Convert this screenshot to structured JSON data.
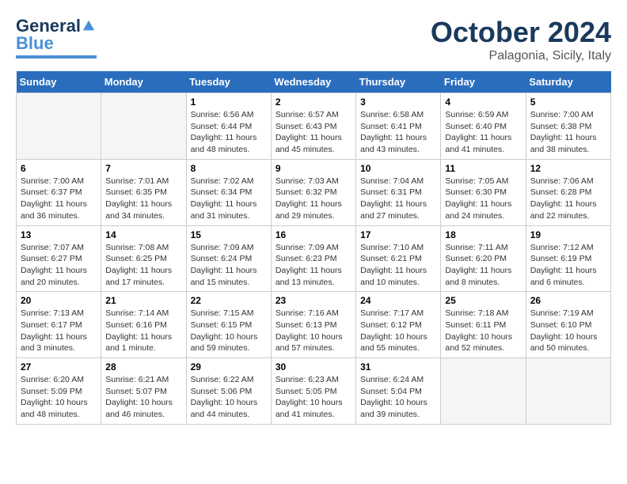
{
  "header": {
    "logo_general": "General",
    "logo_blue": "Blue",
    "month": "October 2024",
    "location": "Palagonia, Sicily, Italy"
  },
  "days_of_week": [
    "Sunday",
    "Monday",
    "Tuesday",
    "Wednesday",
    "Thursday",
    "Friday",
    "Saturday"
  ],
  "weeks": [
    [
      {
        "day": "",
        "empty": true
      },
      {
        "day": "",
        "empty": true
      },
      {
        "day": "1",
        "sunrise": "Sunrise: 6:56 AM",
        "sunset": "Sunset: 6:44 PM",
        "daylight": "Daylight: 11 hours and 48 minutes."
      },
      {
        "day": "2",
        "sunrise": "Sunrise: 6:57 AM",
        "sunset": "Sunset: 6:43 PM",
        "daylight": "Daylight: 11 hours and 45 minutes."
      },
      {
        "day": "3",
        "sunrise": "Sunrise: 6:58 AM",
        "sunset": "Sunset: 6:41 PM",
        "daylight": "Daylight: 11 hours and 43 minutes."
      },
      {
        "day": "4",
        "sunrise": "Sunrise: 6:59 AM",
        "sunset": "Sunset: 6:40 PM",
        "daylight": "Daylight: 11 hours and 41 minutes."
      },
      {
        "day": "5",
        "sunrise": "Sunrise: 7:00 AM",
        "sunset": "Sunset: 6:38 PM",
        "daylight": "Daylight: 11 hours and 38 minutes."
      }
    ],
    [
      {
        "day": "6",
        "sunrise": "Sunrise: 7:00 AM",
        "sunset": "Sunset: 6:37 PM",
        "daylight": "Daylight: 11 hours and 36 minutes."
      },
      {
        "day": "7",
        "sunrise": "Sunrise: 7:01 AM",
        "sunset": "Sunset: 6:35 PM",
        "daylight": "Daylight: 11 hours and 34 minutes."
      },
      {
        "day": "8",
        "sunrise": "Sunrise: 7:02 AM",
        "sunset": "Sunset: 6:34 PM",
        "daylight": "Daylight: 11 hours and 31 minutes."
      },
      {
        "day": "9",
        "sunrise": "Sunrise: 7:03 AM",
        "sunset": "Sunset: 6:32 PM",
        "daylight": "Daylight: 11 hours and 29 minutes."
      },
      {
        "day": "10",
        "sunrise": "Sunrise: 7:04 AM",
        "sunset": "Sunset: 6:31 PM",
        "daylight": "Daylight: 11 hours and 27 minutes."
      },
      {
        "day": "11",
        "sunrise": "Sunrise: 7:05 AM",
        "sunset": "Sunset: 6:30 PM",
        "daylight": "Daylight: 11 hours and 24 minutes."
      },
      {
        "day": "12",
        "sunrise": "Sunrise: 7:06 AM",
        "sunset": "Sunset: 6:28 PM",
        "daylight": "Daylight: 11 hours and 22 minutes."
      }
    ],
    [
      {
        "day": "13",
        "sunrise": "Sunrise: 7:07 AM",
        "sunset": "Sunset: 6:27 PM",
        "daylight": "Daylight: 11 hours and 20 minutes."
      },
      {
        "day": "14",
        "sunrise": "Sunrise: 7:08 AM",
        "sunset": "Sunset: 6:25 PM",
        "daylight": "Daylight: 11 hours and 17 minutes."
      },
      {
        "day": "15",
        "sunrise": "Sunrise: 7:09 AM",
        "sunset": "Sunset: 6:24 PM",
        "daylight": "Daylight: 11 hours and 15 minutes."
      },
      {
        "day": "16",
        "sunrise": "Sunrise: 7:09 AM",
        "sunset": "Sunset: 6:23 PM",
        "daylight": "Daylight: 11 hours and 13 minutes."
      },
      {
        "day": "17",
        "sunrise": "Sunrise: 7:10 AM",
        "sunset": "Sunset: 6:21 PM",
        "daylight": "Daylight: 11 hours and 10 minutes."
      },
      {
        "day": "18",
        "sunrise": "Sunrise: 7:11 AM",
        "sunset": "Sunset: 6:20 PM",
        "daylight": "Daylight: 11 hours and 8 minutes."
      },
      {
        "day": "19",
        "sunrise": "Sunrise: 7:12 AM",
        "sunset": "Sunset: 6:19 PM",
        "daylight": "Daylight: 11 hours and 6 minutes."
      }
    ],
    [
      {
        "day": "20",
        "sunrise": "Sunrise: 7:13 AM",
        "sunset": "Sunset: 6:17 PM",
        "daylight": "Daylight: 11 hours and 3 minutes."
      },
      {
        "day": "21",
        "sunrise": "Sunrise: 7:14 AM",
        "sunset": "Sunset: 6:16 PM",
        "daylight": "Daylight: 11 hours and 1 minute."
      },
      {
        "day": "22",
        "sunrise": "Sunrise: 7:15 AM",
        "sunset": "Sunset: 6:15 PM",
        "daylight": "Daylight: 10 hours and 59 minutes."
      },
      {
        "day": "23",
        "sunrise": "Sunrise: 7:16 AM",
        "sunset": "Sunset: 6:13 PM",
        "daylight": "Daylight: 10 hours and 57 minutes."
      },
      {
        "day": "24",
        "sunrise": "Sunrise: 7:17 AM",
        "sunset": "Sunset: 6:12 PM",
        "daylight": "Daylight: 10 hours and 55 minutes."
      },
      {
        "day": "25",
        "sunrise": "Sunrise: 7:18 AM",
        "sunset": "Sunset: 6:11 PM",
        "daylight": "Daylight: 10 hours and 52 minutes."
      },
      {
        "day": "26",
        "sunrise": "Sunrise: 7:19 AM",
        "sunset": "Sunset: 6:10 PM",
        "daylight": "Daylight: 10 hours and 50 minutes."
      }
    ],
    [
      {
        "day": "27",
        "sunrise": "Sunrise: 6:20 AM",
        "sunset": "Sunset: 5:09 PM",
        "daylight": "Daylight: 10 hours and 48 minutes."
      },
      {
        "day": "28",
        "sunrise": "Sunrise: 6:21 AM",
        "sunset": "Sunset: 5:07 PM",
        "daylight": "Daylight: 10 hours and 46 minutes."
      },
      {
        "day": "29",
        "sunrise": "Sunrise: 6:22 AM",
        "sunset": "Sunset: 5:06 PM",
        "daylight": "Daylight: 10 hours and 44 minutes."
      },
      {
        "day": "30",
        "sunrise": "Sunrise: 6:23 AM",
        "sunset": "Sunset: 5:05 PM",
        "daylight": "Daylight: 10 hours and 41 minutes."
      },
      {
        "day": "31",
        "sunrise": "Sunrise: 6:24 AM",
        "sunset": "Sunset: 5:04 PM",
        "daylight": "Daylight: 10 hours and 39 minutes."
      },
      {
        "day": "",
        "empty": true
      },
      {
        "day": "",
        "empty": true
      }
    ]
  ]
}
